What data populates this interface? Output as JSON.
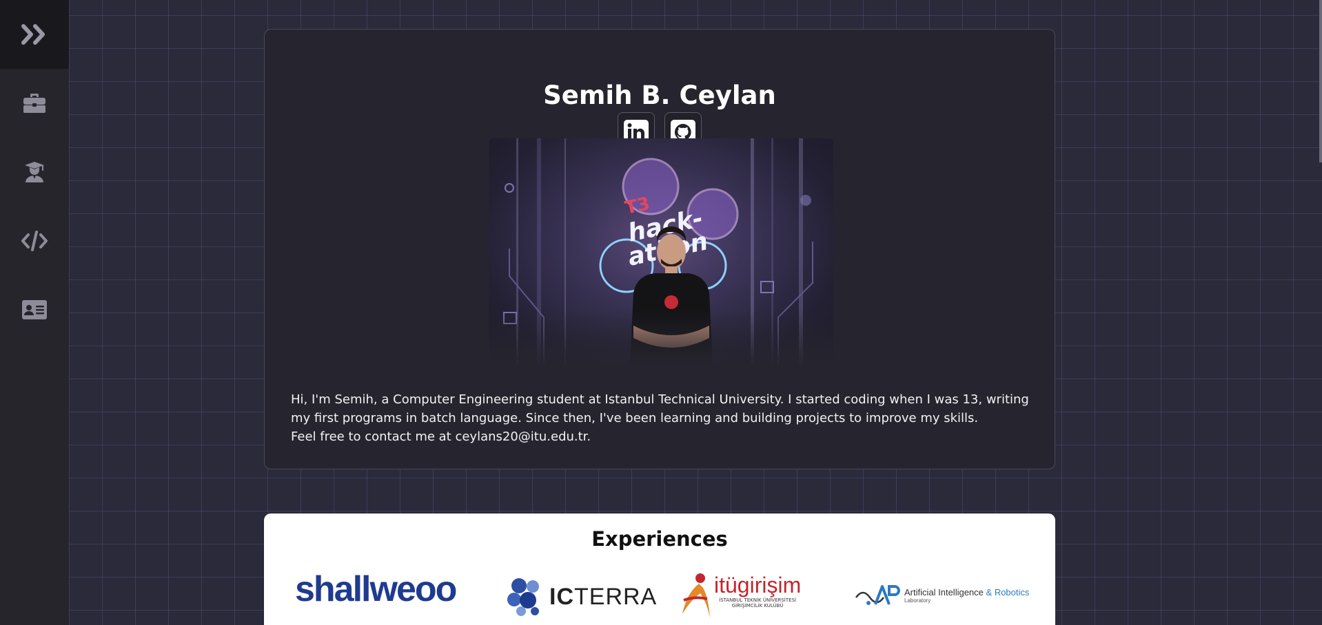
{
  "sidebar": {
    "toggle_icon": "double-chevron-right-icon",
    "items": [
      {
        "icon": "briefcase-icon"
      },
      {
        "icon": "graduate-icon"
      },
      {
        "icon": "code-icon"
      },
      {
        "icon": "id-card-icon"
      }
    ]
  },
  "profile": {
    "name": "Semih B. Ceylan",
    "social": [
      {
        "icon": "linkedin-icon"
      },
      {
        "icon": "github-icon"
      }
    ],
    "photo_banner_text": "T3 hack-athon",
    "bio_line1": "Hi, I'm Semih, a Computer Engineering student at Istanbul Technical University. I started coding when I was 13, writing my first programs in batch language. Since then, I've been learning and building projects to improve my skills.",
    "bio_line2": "Feel free to contact me at ceylans20@itu.edu.tr."
  },
  "experiences": {
    "title": "Experiences",
    "logos": {
      "shallweo": "shallweoo",
      "icterra_ic": "IC",
      "icterra_rest": "TERRA",
      "itu_main": "itügirişim",
      "itu_sub1": "İSTANBUL TEKNİK ÜNİVERSİTESİ",
      "itu_sub2": "GİRİŞİMCİLİK KULÜBÜ",
      "air_main": "Artificial Intelligence",
      "air_amp": "&",
      "air_robotics": "Robotics",
      "air_lab": "Laboratory"
    }
  },
  "colors": {
    "background": "#2b2a3a",
    "sidebar": "#26252b",
    "card": "#26252f",
    "icon": "#8e8c99"
  }
}
